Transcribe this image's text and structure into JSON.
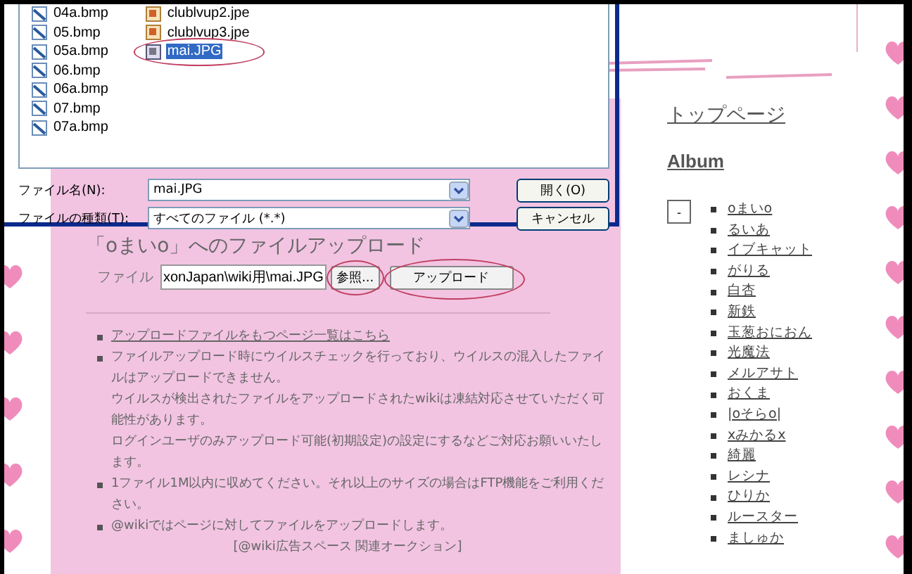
{
  "dialog": {
    "files": [
      {
        "name": "04a.bmp",
        "kind": "bmp",
        "selected": false,
        "circled": false
      },
      {
        "name": "05.bmp",
        "kind": "bmp",
        "selected": false,
        "circled": false
      },
      {
        "name": "05a.bmp",
        "kind": "bmp",
        "selected": false,
        "circled": false
      },
      {
        "name": "06.bmp",
        "kind": "bmp",
        "selected": false,
        "circled": false
      },
      {
        "name": "06a.bmp",
        "kind": "bmp",
        "selected": false,
        "circled": false
      },
      {
        "name": "07.bmp",
        "kind": "bmp",
        "selected": false,
        "circled": false
      },
      {
        "name": "07a.bmp",
        "kind": "bmp",
        "selected": false,
        "circled": false
      },
      {
        "name": "clublvup2.jpe",
        "kind": "jpe",
        "selected": false,
        "circled": false
      },
      {
        "name": "clublvup3.jpe",
        "kind": "jpe",
        "selected": false,
        "circled": false
      },
      {
        "name": "mai.JPG",
        "kind": "jpg",
        "selected": true,
        "circled": true
      }
    ],
    "filename_label": "ファイル名(N):",
    "filename_value": "mai.JPG",
    "filetype_label": "ファイルの種類(T):",
    "filetype_value": "すべてのファイル (*.*)",
    "buttons": [
      "開く(O)",
      "キャンセル"
    ]
  },
  "page": {
    "title": "「oまいo」へのファイルアップロード",
    "file_label": "ファイル",
    "file_value": "xonJapan\\wiki用\\mai.JPG",
    "browse_button": {
      "label": "参照...",
      "circled": true
    },
    "upload_button": {
      "label": "アップロード",
      "circled": true
    },
    "notes": [
      {
        "kind": "link",
        "paragraphs": [
          "アップロードファイルをもつページ一覧はこちら"
        ]
      },
      {
        "kind": "text",
        "paragraphs": [
          "ファイルアップロード時にウイルスチェックを行っており、ウイルスの混入したファイルはアップロードできません。",
          "ウイルスが検出されたファイルをアップロードされたwikiは凍結対応させていただく可能性があります。",
          "ログインユーザのみアップロード可能(初期設定)の設定にするなどご対応お願いいたします。"
        ]
      },
      {
        "kind": "text",
        "paragraphs": [
          "1ファイル1M以内に収めてください。それ以上のサイズの場合はFTP機能をご利用ください。"
        ]
      },
      {
        "kind": "text",
        "paragraphs": [
          "@wikiではページに対してファイルをアップロードします。"
        ]
      }
    ],
    "ad": "[@wiki広告スペース 関連オークション]"
  },
  "sidebar": {
    "top_link": "トップページ",
    "album_heading": "Album",
    "collapse_toggle": "-",
    "albums": [
      "oまいo",
      "るいあ",
      "イブキャット",
      "がりる",
      "白杏",
      "新鉄",
      "玉葱おにおん",
      "光魔法",
      "メルアサト",
      "おくま",
      "|oそらo|",
      "xみかるx",
      "綺麗",
      "レシナ",
      "ひりか",
      "ルースター",
      "ましゅか"
    ]
  }
}
